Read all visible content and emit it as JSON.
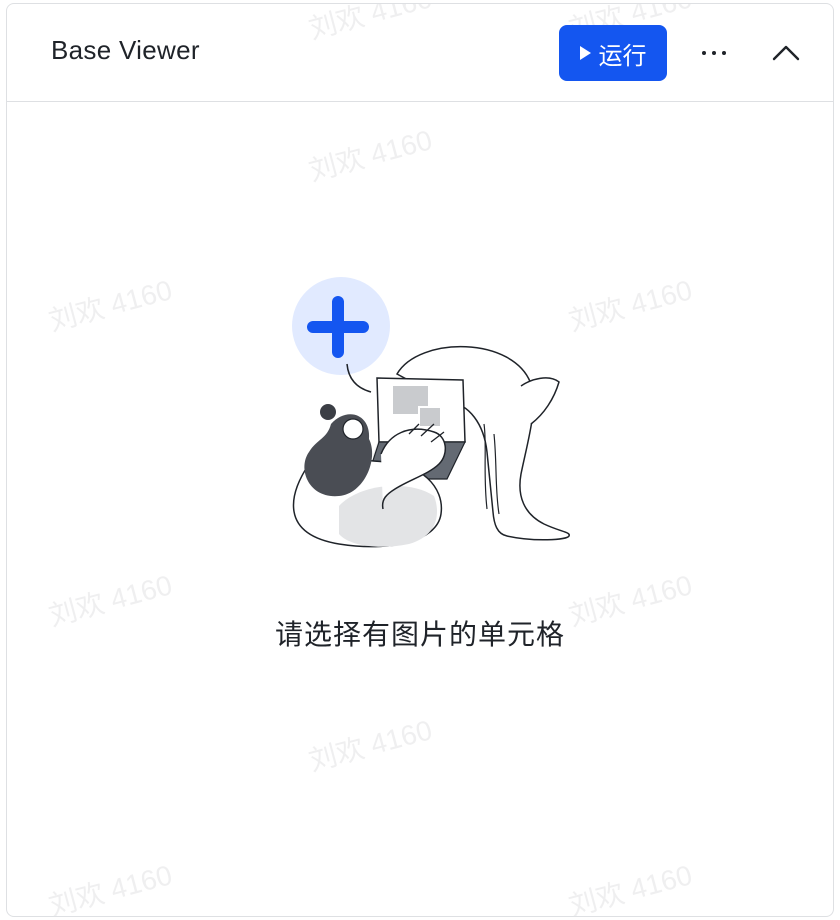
{
  "header": {
    "title": "Base Viewer",
    "run_label": "运行"
  },
  "empty_state": {
    "message": "请选择有图片的单元格"
  },
  "watermark": {
    "text": "刘欢 4160"
  },
  "colors": {
    "accent": "#1456f0",
    "text_primary": "#1f2329",
    "border": "#dee0e3",
    "illustration_circle": "#e1eaff"
  },
  "icons": {
    "run": "play-icon",
    "more": "more-dots-icon",
    "collapse": "chevron-up-icon",
    "illustration": "add-image-illustration"
  }
}
